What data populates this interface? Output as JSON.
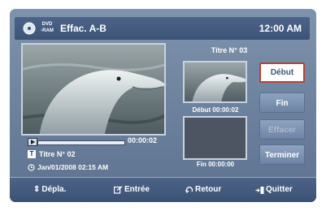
{
  "header": {
    "disc_label": "DVD\n-RAM",
    "title": "Effac. A-B",
    "clock": "12:00 AM"
  },
  "playback": {
    "time": "00:00:02",
    "progress_fraction": 0.0,
    "title_info": "Titre N° 02",
    "date_info": "Jan/01/2008  02:15 AM"
  },
  "edit": {
    "title": "Titre N° 03",
    "start_label": "Début  00:00:02",
    "end_label": "Fin 00:00:00"
  },
  "buttons": {
    "debut": "Début",
    "fin": "Fin",
    "effacer": "Effacer",
    "terminer": "Terminer"
  },
  "footer": {
    "move": "Dépla.",
    "enter": "Entrée",
    "return": "Retour",
    "exit": "Quitter"
  },
  "icons": {
    "disc": "disc-icon",
    "title_badge": "T",
    "clock": "clock-icon",
    "move": "updown-arrows-icon",
    "enter": "enter-icon",
    "return": "return-icon",
    "exit": "exit-icon"
  },
  "colors": {
    "active_border": "#c04030",
    "header_bg": "#3b5377",
    "screen_bg": "#6d829e"
  }
}
